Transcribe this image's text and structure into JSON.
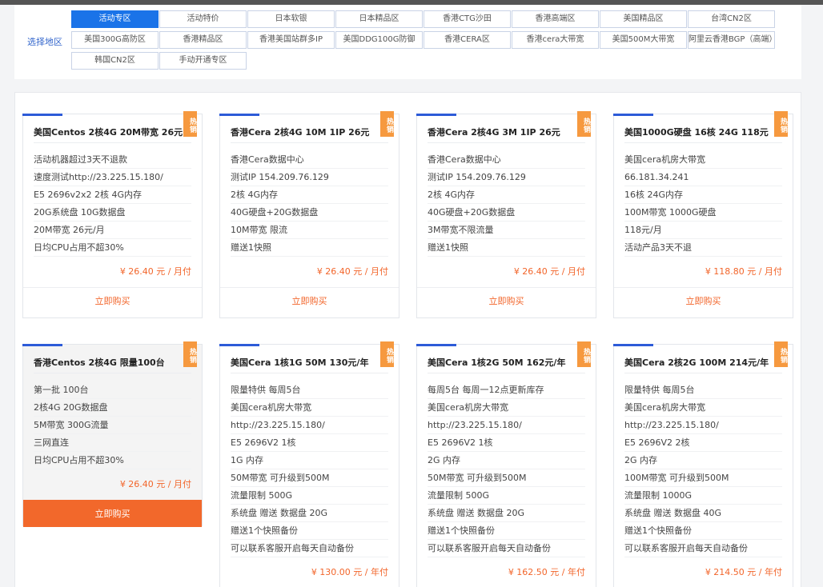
{
  "region": {
    "label": "选择地区",
    "tabs": [
      {
        "label": "活动专区",
        "active": true
      },
      {
        "label": "活动特价"
      },
      {
        "label": "日本软银"
      },
      {
        "label": "日本精品区"
      },
      {
        "label": "香港CTG沙田"
      },
      {
        "label": "香港高端区"
      },
      {
        "label": "美国精品区"
      },
      {
        "label": "台湾CN2区"
      },
      {
        "label": "美国300G高防区"
      },
      {
        "label": "香港精品区"
      },
      {
        "label": "香港美国站群多IP"
      },
      {
        "label": "美国DDG100G防御"
      },
      {
        "label": "香港CERA区"
      },
      {
        "label": "香港cera大带宽"
      },
      {
        "label": "美国500M大带宽"
      },
      {
        "label": "阿里云香港BGP（高端）"
      },
      {
        "label": "韩国CN2区"
      },
      {
        "label": "手动开通专区"
      }
    ]
  },
  "hot_badge": "热销",
  "buy_label": "立即购买",
  "products": [
    {
      "title": "美国Centos 2核4G 20M带宽 26元",
      "features": [
        "活动机器超过3天不退款",
        "速度测试http://23.225.15.180/",
        "E5 2696v2x2 2核 4G内存",
        "20G系统盘 10G数据盘",
        "20M带宽 26元/月",
        "日均CPU占用不超30%"
      ],
      "price": "¥ 26.40 元 / 月付"
    },
    {
      "title": "香港Cera 2核4G 10M 1IP 26元",
      "features": [
        "香港Cera数据中心",
        "测试IP 154.209.76.129",
        "2核 4G内存",
        "40G硬盘+20G数据盘",
        "10M带宽 限流",
        "赠送1快照"
      ],
      "price": "¥ 26.40 元 / 月付"
    },
    {
      "title": "香港Cera 2核4G 3M 1IP 26元",
      "features": [
        "香港Cera数据中心",
        "测试IP 154.209.76.129",
        "2核 4G内存",
        "40G硬盘+20G数据盘",
        "3M带宽不限流量",
        "赠送1快照"
      ],
      "price": "¥ 26.40 元 / 月付"
    },
    {
      "title": "美国1000G硬盘 16核 24G 118元",
      "features": [
        "美国cera机房大带宽",
        "66.181.34.241",
        "16核 24G内存",
        "100M带宽 1000G硬盘",
        "118元/月",
        "活动产品3天不退"
      ],
      "price": "¥ 118.80 元 / 月付"
    },
    {
      "title": "香港Centos 2核4G 限量100台",
      "features": [
        "第一批 100台",
        "2核4G 20G数据盘",
        "5M带宽 300G流量",
        "三网直连",
        "日均CPU占用不超30%"
      ],
      "price": "¥ 26.40 元 / 月付"
    },
    {
      "title": "美国Cera 1核1G 50M 130元/年",
      "features": [
        "限量特供 每周5台",
        "美国cera机房大带宽",
        "http://23.225.15.180/",
        "E5 2696V2 1核",
        "1G 内存",
        "50M带宽 可升级到500M",
        "流量限制 500G",
        "系统盘 赠送 数据盘 20G",
        "赠送1个快照备份",
        "可以联系客服开启每天自动备份"
      ],
      "price": "¥ 130.00 元 / 年付"
    },
    {
      "title": "美国Cera 1核2G 50M 162元/年",
      "features": [
        "每周5台 每周一12点更新库存",
        "美国cera机房大带宽",
        "http://23.225.15.180/",
        "E5 2696V2 1核",
        "2G 内存",
        "50M带宽 可升级到500M",
        "流量限制 500G",
        "系统盘 赠送 数据盘 20G",
        "赠送1个快照备份",
        "可以联系客服开启每天自动备份"
      ],
      "price": "¥ 162.50 元 / 年付"
    },
    {
      "title": "美国Cera 2核2G 100M 214元/年",
      "features": [
        "限量特供 每周5台",
        "美国cera机房大带宽",
        "http://23.225.15.180/",
        "E5 2696V2 2核",
        "2G 内存",
        "100M带宽 可升级到500M",
        "流量限制 1000G",
        "系统盘 赠送 数据盘 40G",
        "赠送1个快照备份",
        "可以联系客服开启每天自动备份"
      ],
      "price": "¥ 214.50 元 / 年付"
    }
  ],
  "colors": {
    "accent_blue": "#1a73e8",
    "accent_bar": "#2d5bd8",
    "price_orange": "#f2652a",
    "hot_badge": "#f6993f"
  }
}
